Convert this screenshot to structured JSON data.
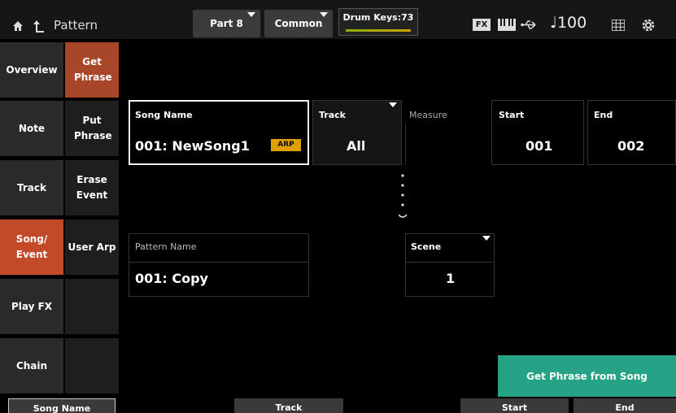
{
  "header": {
    "title": "Pattern",
    "part": "Part 8",
    "common": "Common",
    "drum_keys": "Drum Keys:73",
    "fx": "FX",
    "tempo": "♩100"
  },
  "nav_primary": [
    {
      "label": "Overview"
    },
    {
      "label": "Note"
    },
    {
      "label": "Track"
    },
    {
      "label": "Song/ Event",
      "active": true
    },
    {
      "label": "Play FX"
    },
    {
      "label": "Chain"
    }
  ],
  "nav_secondary": [
    {
      "label": "Get Phrase",
      "active": true
    },
    {
      "label": "Put Phrase"
    },
    {
      "label": "Erase Event"
    },
    {
      "label": "User Arp"
    },
    {
      "label": ""
    },
    {
      "label": ""
    }
  ],
  "form": {
    "song_name_label": "Song Name",
    "song_name_value": "001: NewSong1",
    "arp_badge": "ARP",
    "track_label": "Track",
    "track_value": "All",
    "measure_label": "Measure",
    "start_label": "Start",
    "start_value": "001",
    "end_label": "End",
    "end_value": "002",
    "pattern_name_label": "Pattern Name",
    "pattern_name_value": "001: Copy",
    "scene_label": "Scene",
    "scene_value": "1"
  },
  "action_button": "Get Phrase from Song",
  "bottom_bar": [
    "Song Name",
    "Track",
    "Start",
    "End"
  ],
  "colors": {
    "active_nav": "#c24a28",
    "active_subnav": "#a8462a",
    "action": "#26a386",
    "arp_badge": "#e0a000"
  }
}
